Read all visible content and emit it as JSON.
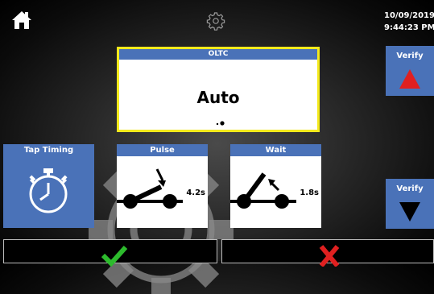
{
  "header": {
    "date": "10/09/2019",
    "time": "9:44:23 PM",
    "home_icon": "home-icon",
    "settings_icon": "gear-icon"
  },
  "oltc": {
    "title": "OLTC",
    "mode": "Auto"
  },
  "verify_up": {
    "label": "Verify",
    "icon": "triangle-up-icon",
    "icon_color": "#e02020"
  },
  "verify_down": {
    "label": "Verify",
    "icon": "triangle-down-icon",
    "icon_color": "#000000"
  },
  "tap_timing": {
    "label": "Tap Timing",
    "icon": "stopwatch-icon"
  },
  "pulse": {
    "title": "Pulse",
    "value": "4.2s",
    "icon": "switch-closing-icon"
  },
  "wait": {
    "title": "Wait",
    "value": "1.8s",
    "icon": "switch-opening-icon"
  },
  "actions": {
    "confirm_icon": "checkmark-icon",
    "cancel_icon": "x-icon",
    "confirm_color": "#2dbb2d",
    "cancel_color": "#e02020"
  },
  "colors": {
    "panel_blue": "#4a72b8",
    "highlight_yellow": "#f4ea1c"
  }
}
